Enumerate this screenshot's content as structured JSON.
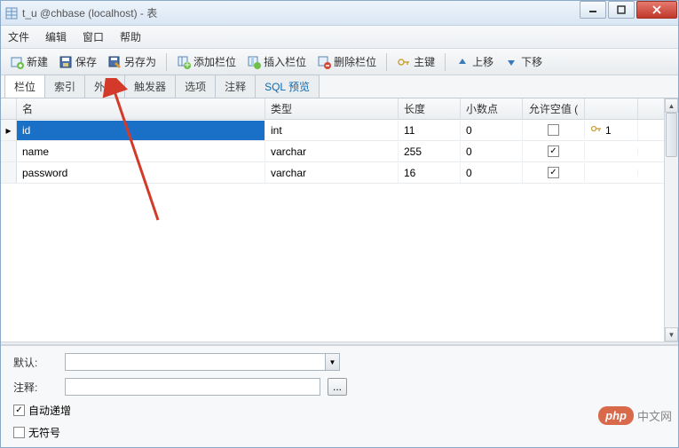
{
  "window": {
    "title": "t_u @chbase (localhost) - 表"
  },
  "menus": [
    "文件",
    "编辑",
    "窗口",
    "帮助"
  ],
  "toolbar": {
    "new": "新建",
    "save": "保存",
    "saveas": "另存为",
    "addcol": "添加栏位",
    "inscol": "插入栏位",
    "delcol": "删除栏位",
    "primary": "主键",
    "moveup": "上移",
    "movedown": "下移"
  },
  "tabs": [
    "栏位",
    "索引",
    "外键",
    "触发器",
    "选项",
    "注释",
    "SQL 预览"
  ],
  "grid": {
    "headers": {
      "name": "名",
      "type": "类型",
      "length": "长度",
      "decimals": "小数点",
      "allownull": "允许空值 ("
    },
    "rows": [
      {
        "name": "id",
        "type": "int",
        "length": "11",
        "decimals": "0",
        "allownull": false,
        "key": "1",
        "selected": true
      },
      {
        "name": "name",
        "type": "varchar",
        "length": "255",
        "decimals": "0",
        "allownull": true,
        "key": "",
        "selected": false
      },
      {
        "name": "password",
        "type": "varchar",
        "length": "16",
        "decimals": "0",
        "allownull": true,
        "key": "",
        "selected": false
      }
    ]
  },
  "bottom": {
    "default_label": "默认:",
    "comment_label": "注释:",
    "autoinc_label": "自动递增",
    "unsigned_label": "无符号",
    "autoinc_checked": true,
    "unsigned_checked": false,
    "dots": "..."
  },
  "watermark": {
    "badge": "php",
    "text": "中文网"
  }
}
